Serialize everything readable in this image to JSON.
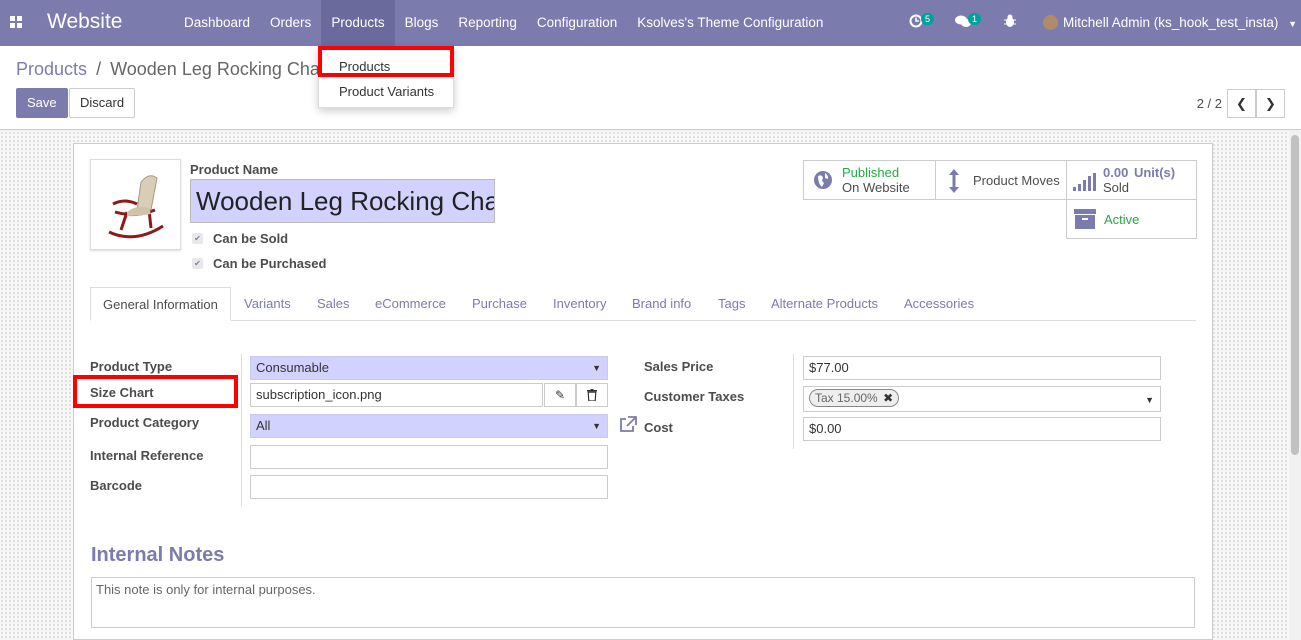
{
  "navbar": {
    "brand": "Website",
    "menu": [
      "Dashboard",
      "Orders",
      "Products",
      "Blogs",
      "Reporting",
      "Configuration",
      "Ksolves's Theme Configuration"
    ],
    "activity_count": "5",
    "message_count": "1",
    "user": "Mitchell Admin (ks_hook_test_insta)",
    "color": "#7c7bad"
  },
  "dropdown": {
    "items": [
      "Products",
      "Product Variants"
    ]
  },
  "breadcrumb": {
    "parent": "Products",
    "separator": "/",
    "current": "Wooden Leg Rocking Chai"
  },
  "buttons": {
    "save": "Save",
    "discard": "Discard"
  },
  "pager": {
    "value": "2 / 2"
  },
  "product": {
    "name_label": "Product Name",
    "name": "Wooden Leg Rocking Chair",
    "can_be_sold": "Can be Sold",
    "can_be_purchased": "Can be Purchased"
  },
  "stats": {
    "published_1": "Published",
    "published_2": "On Website",
    "moves": "Product Moves",
    "sold_value": "0.00",
    "sold_unit": "Unit(s)",
    "sold_label": "Sold",
    "active": "Active"
  },
  "tabs": [
    "General Information",
    "Variants",
    "Sales",
    "eCommerce",
    "Purchase",
    "Inventory",
    "Brand info",
    "Tags",
    "Alternate Products",
    "Accessories"
  ],
  "form": {
    "product_type_label": "Product Type",
    "product_type": "Consumable",
    "size_chart_label": "Size Chart",
    "size_chart": "subscription_icon.png",
    "category_label": "Product Category",
    "category": "All",
    "internal_ref_label": "Internal Reference",
    "internal_ref": "",
    "barcode_label": "Barcode",
    "barcode": "",
    "sales_price_label": "Sales Price",
    "sales_price": "$77.00",
    "taxes_label": "Customer Taxes",
    "tax_tag": "Tax 15.00%",
    "cost_label": "Cost",
    "cost": "$0.00"
  },
  "notes": {
    "title": "Internal Notes",
    "placeholder": "This note is only for internal purposes."
  }
}
